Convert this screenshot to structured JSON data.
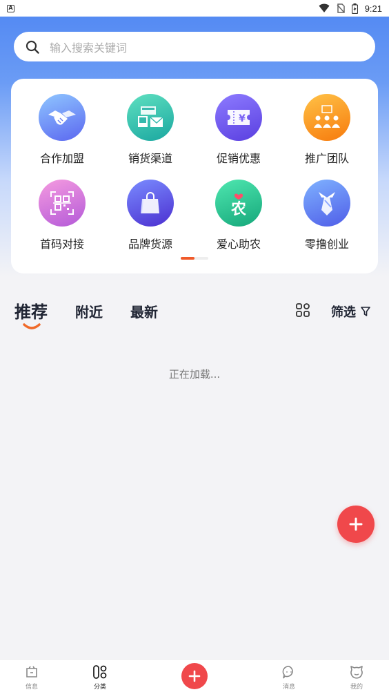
{
  "status_bar": {
    "time": "9:21",
    "app_badge": "A"
  },
  "search": {
    "placeholder": "输入搜索关键词"
  },
  "categories": [
    {
      "label": "合作加盟",
      "icon": "handshake-icon"
    },
    {
      "label": "销货渠道",
      "icon": "store-channel-icon"
    },
    {
      "label": "促销优惠",
      "icon": "coupon-icon",
      "glyph": "¥"
    },
    {
      "label": "推广团队",
      "icon": "team-icon"
    },
    {
      "label": "首码对接",
      "icon": "qr-code-icon"
    },
    {
      "label": "品牌货源",
      "icon": "shopping-bag-icon"
    },
    {
      "label": "爱心助农",
      "icon": "farm-help-icon",
      "glyph": "农"
    },
    {
      "label": "零撸创业",
      "icon": "tie-icon"
    }
  ],
  "tabs": {
    "recommend": "推荐",
    "nearby": "附近",
    "latest": "最新",
    "filter": "筛选"
  },
  "loading_text": "正在加载...",
  "bottom_nav": {
    "info": "信息",
    "category": "分类",
    "messages": "消息",
    "mine": "我的"
  },
  "colors": {
    "accent": "#f0484b",
    "tab_underline": "#f06a2a",
    "header_blue": "#4f86f2"
  }
}
